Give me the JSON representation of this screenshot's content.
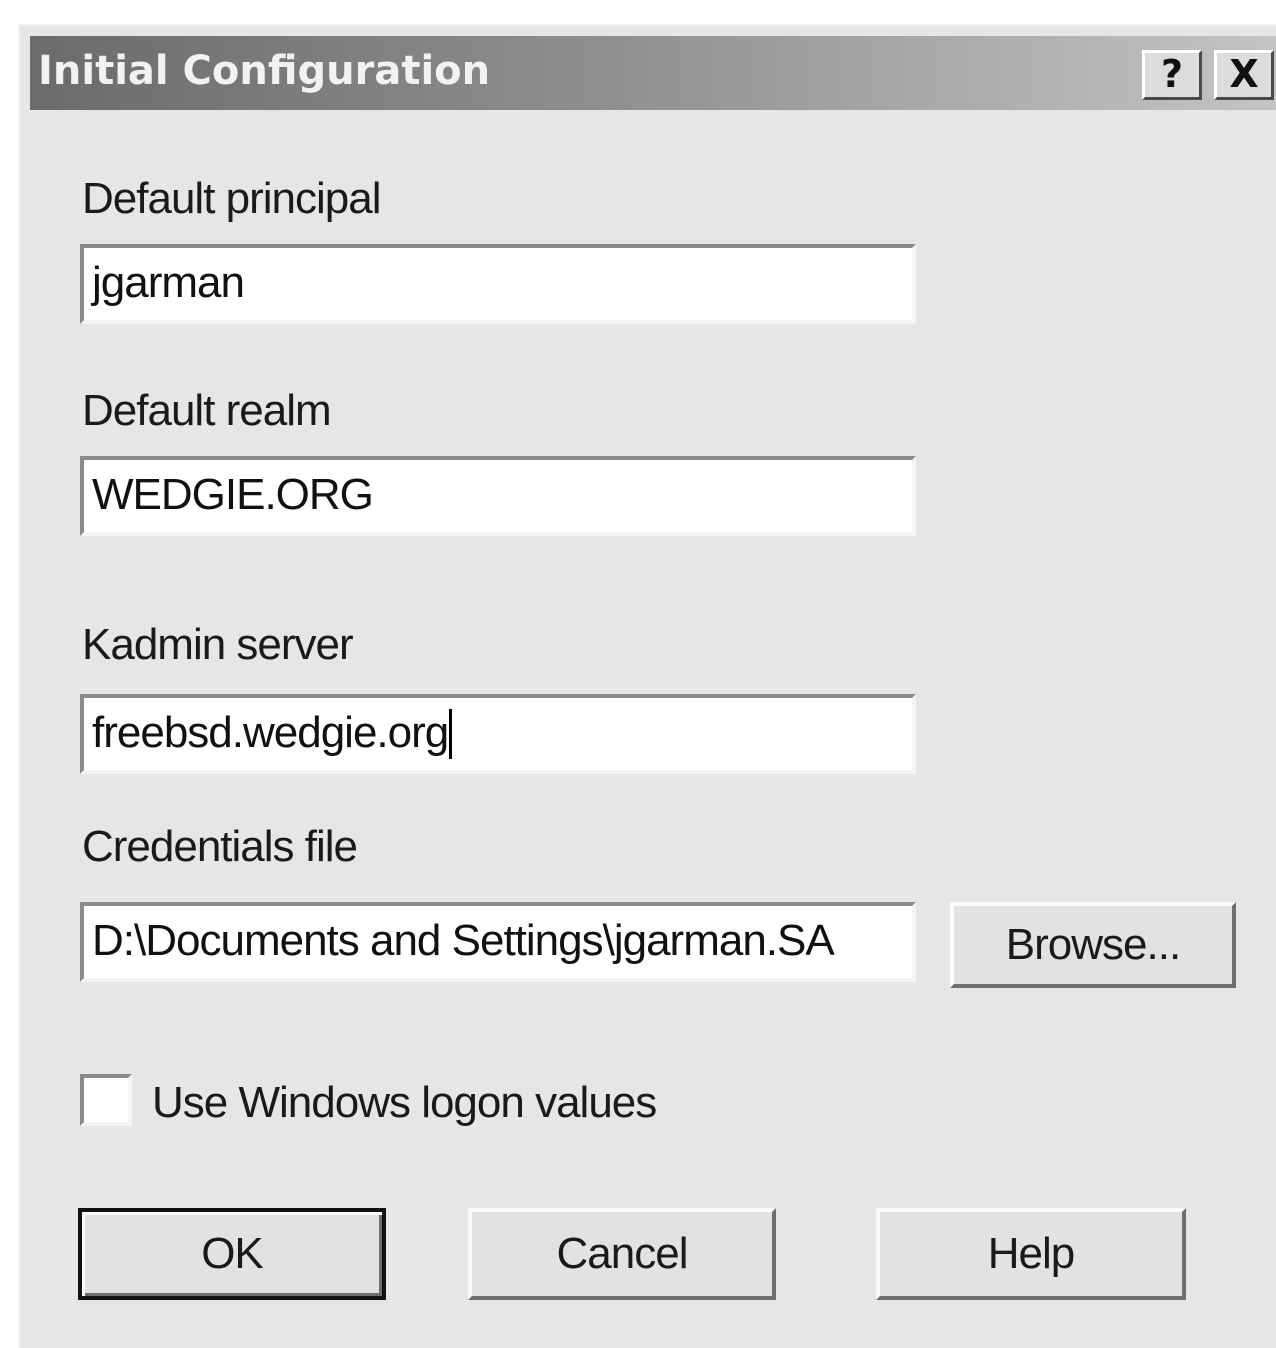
{
  "window": {
    "title": "Initial Configuration",
    "help_button": "?",
    "close_button": "X"
  },
  "form": {
    "principal": {
      "label": "Default principal",
      "value": "jgarman"
    },
    "realm": {
      "label": "Default realm",
      "value": "WEDGIE.ORG"
    },
    "kadmin": {
      "label": "Kadmin server",
      "value": "freebsd.wedgie.org"
    },
    "credentials": {
      "label": "Credentials file",
      "value": "D:\\Documents and Settings\\jgarman.SA",
      "browse_label": "Browse..."
    },
    "use_windows_logon": {
      "label": "Use Windows logon values",
      "checked": false
    }
  },
  "buttons": {
    "ok": "OK",
    "cancel": "Cancel",
    "help": "Help"
  }
}
